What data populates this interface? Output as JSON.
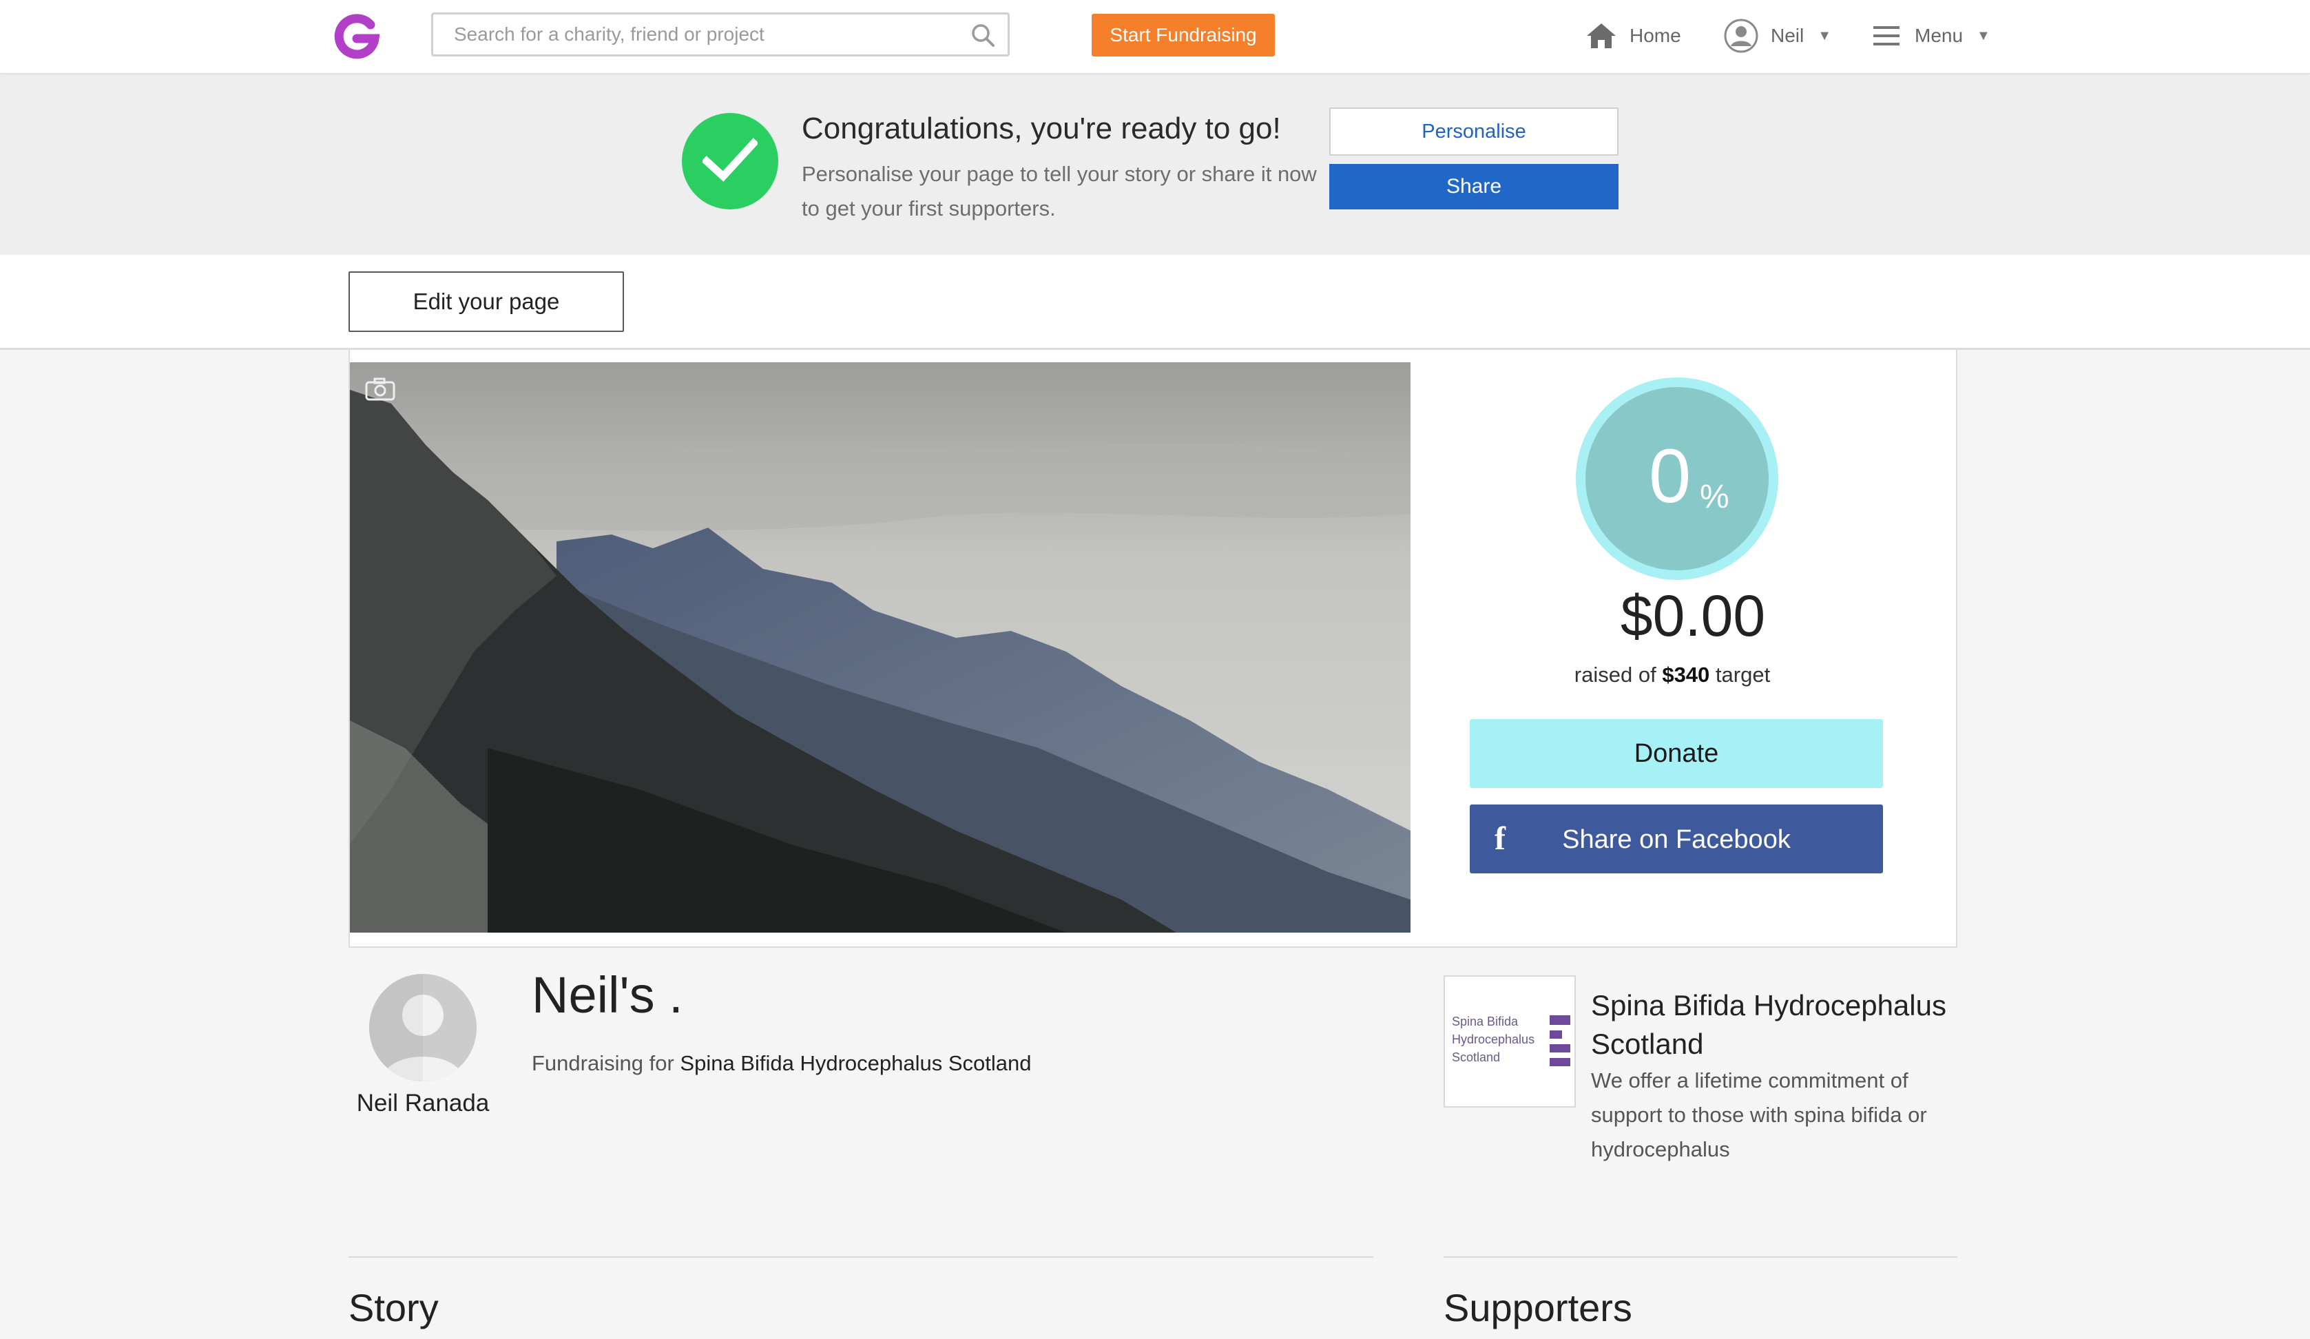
{
  "nav": {
    "search_placeholder": "Search for a charity, friend or project",
    "start_label": "Start Fundraising",
    "home_label": "Home",
    "user_label": "Neil",
    "menu_label": "Menu"
  },
  "banner": {
    "title": "Congratulations, you're ready to go!",
    "text": "Personalise your page to tell your story or share it now to get your first supporters.",
    "personalise_label": "Personalise",
    "share_label": "Share"
  },
  "edit": {
    "label": "Edit your page"
  },
  "progress": {
    "percent": "0",
    "percent_sign": "%",
    "amount": "$0.00",
    "raised_prefix": "raised of",
    "target": "$340",
    "raised_suffix": "target"
  },
  "actions": {
    "donate_label": "Donate",
    "facebook_label": "Share on Facebook",
    "facebook_glyph": "f"
  },
  "profile": {
    "owner_name": "Neil Ranada",
    "page_title": "Neil's .",
    "fundraising_for_prefix": "Fundraising for",
    "charity_link": "Spina Bifida Hydrocephalus Scotland"
  },
  "charity": {
    "logo_lines": [
      "Spina Bifida",
      "Hydrocephalus",
      "Scotland"
    ],
    "name": "Spina Bifida Hydrocephalus Scotland",
    "description": "We offer a lifetime commitment of support to those with spina bifida or hydrocephalus"
  },
  "sections": {
    "story": "Story",
    "supporters": "Supporters"
  },
  "colors": {
    "brand": "#b23fc8",
    "start_button": "#f57f2a",
    "share_button": "#2067c7",
    "check": "#2bcf61",
    "progress": "#88c8c8",
    "donate": "#a6f1f5",
    "facebook": "#3e5a9c"
  }
}
